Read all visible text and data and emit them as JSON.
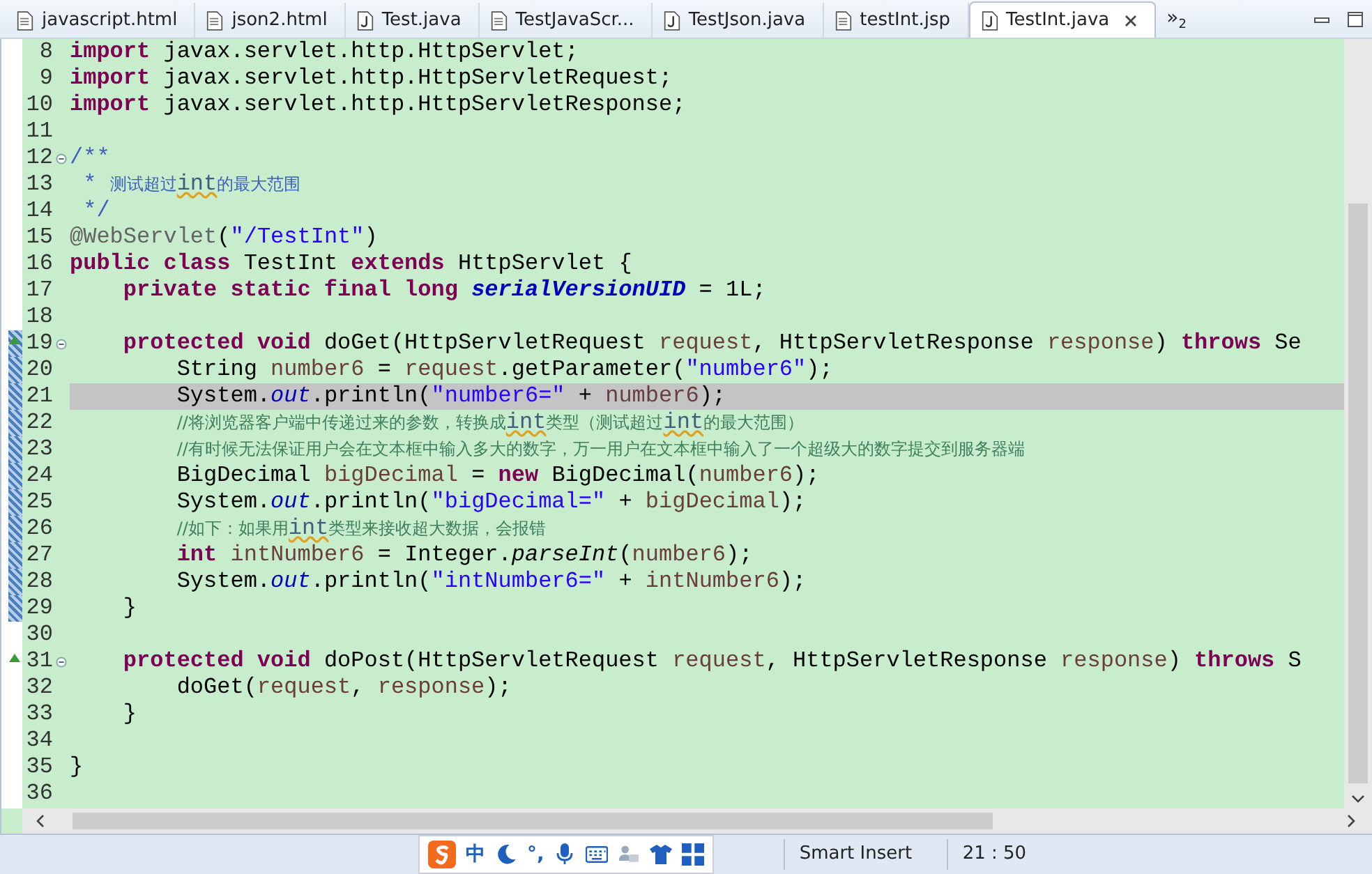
{
  "tabs": [
    {
      "label": "javascript.html",
      "kind": "html",
      "selected": false
    },
    {
      "label": "json2.html",
      "kind": "html",
      "selected": false
    },
    {
      "label": "Test.java",
      "kind": "java",
      "selected": false
    },
    {
      "label": "TestJavaScr...",
      "kind": "html",
      "selected": false
    },
    {
      "label": "TestJson.java",
      "kind": "java",
      "selected": false
    },
    {
      "label": "testInt.jsp",
      "kind": "html",
      "selected": false
    },
    {
      "label": "TestInt.java",
      "kind": "java",
      "selected": true
    }
  ],
  "overflow": {
    "symbol": "»",
    "count": "2"
  },
  "editor": {
    "lines": [
      {
        "number": "8",
        "current": false,
        "changed": false,
        "override": false,
        "foldable": false,
        "tokens": [
          {
            "kind": "kw",
            "text": "import"
          },
          {
            "kind": "plain",
            "text": " javax.servlet.http.HttpServlet;"
          }
        ]
      },
      {
        "number": "9",
        "current": false,
        "changed": false,
        "override": false,
        "foldable": false,
        "tokens": [
          {
            "kind": "kw",
            "text": "import"
          },
          {
            "kind": "plain",
            "text": " javax.servlet.http.HttpServletRequest;"
          }
        ]
      },
      {
        "number": "10",
        "current": false,
        "changed": false,
        "override": false,
        "foldable": false,
        "tokens": [
          {
            "kind": "kw",
            "text": "import"
          },
          {
            "kind": "plain",
            "text": " javax.servlet.http.HttpServletResponse;"
          }
        ]
      },
      {
        "number": "11",
        "current": false,
        "changed": false,
        "override": false,
        "foldable": false
      },
      {
        "number": "12",
        "current": false,
        "changed": false,
        "override": false,
        "foldable": true,
        "tokens": [
          {
            "kind": "doc",
            "text": "/**"
          }
        ]
      },
      {
        "number": "13",
        "current": false,
        "changed": false,
        "override": false,
        "foldable": false,
        "tokens": [
          {
            "kind": "doc",
            "text": " * "
          },
          {
            "kind": "doccjk",
            "text": "测试超过"
          },
          {
            "kind": "spell",
            "text": "int"
          },
          {
            "kind": "doccjk",
            "text": "的最大范围"
          }
        ]
      },
      {
        "number": "14",
        "current": false,
        "changed": false,
        "override": false,
        "foldable": false,
        "tokens": [
          {
            "kind": "doc",
            "text": " */"
          }
        ]
      },
      {
        "number": "15",
        "current": false,
        "changed": false,
        "override": false,
        "foldable": false,
        "tokens": [
          {
            "kind": "ann",
            "text": "@WebServlet"
          },
          {
            "kind": "plain",
            "text": "("
          },
          {
            "kind": "str",
            "text": "\"/TestInt\""
          },
          {
            "kind": "plain",
            "text": ")"
          }
        ]
      },
      {
        "number": "16",
        "current": false,
        "changed": false,
        "override": false,
        "foldable": false,
        "tokens": [
          {
            "kind": "kw",
            "text": "public class"
          },
          {
            "kind": "plain",
            "text": " TestInt "
          },
          {
            "kind": "kw",
            "text": "extends"
          },
          {
            "kind": "plain",
            "text": " HttpServlet {"
          }
        ]
      },
      {
        "number": "17",
        "current": false,
        "changed": false,
        "override": false,
        "foldable": false,
        "tokens": [
          {
            "kind": "kw",
            "text": "    private static final long"
          },
          {
            "kind": "field",
            "text": " serialVersionUID"
          },
          {
            "kind": "plain",
            "text": " = 1L;"
          }
        ]
      },
      {
        "number": "18",
        "current": false,
        "changed": false,
        "override": false,
        "foldable": false
      },
      {
        "number": "19",
        "current": false,
        "changed": true,
        "override": true,
        "foldable": true,
        "tokens": [
          {
            "kind": "kw",
            "text": "    protected void"
          },
          {
            "kind": "plain",
            "text": " doGet(HttpServletRequest "
          },
          {
            "kind": "param",
            "text": "request"
          },
          {
            "kind": "plain",
            "text": ", HttpServletResponse "
          },
          {
            "kind": "param",
            "text": "response"
          },
          {
            "kind": "plain",
            "text": ") "
          },
          {
            "kind": "kw",
            "text": "throws"
          },
          {
            "kind": "plain",
            "text": " Se"
          }
        ]
      },
      {
        "number": "20",
        "current": false,
        "changed": true,
        "override": false,
        "foldable": false,
        "tokens": [
          {
            "kind": "plain",
            "text": "        String "
          },
          {
            "kind": "param",
            "text": "number6"
          },
          {
            "kind": "plain",
            "text": " = "
          },
          {
            "kind": "param",
            "text": "request"
          },
          {
            "kind": "plain",
            "text": ".getParameter("
          },
          {
            "kind": "str",
            "text": "\"number6\""
          },
          {
            "kind": "plain",
            "text": ");"
          }
        ]
      },
      {
        "number": "21",
        "current": true,
        "changed": true,
        "override": false,
        "foldable": false,
        "tokens": [
          {
            "kind": "plain",
            "text": "        System."
          },
          {
            "kind": "sfield",
            "text": "out"
          },
          {
            "kind": "plain",
            "text": ".println("
          },
          {
            "kind": "str",
            "text": "\"number6=\""
          },
          {
            "kind": "plain",
            "text": " + "
          },
          {
            "kind": "param",
            "text": "number6"
          },
          {
            "kind": "plain",
            "text": ");"
          }
        ]
      },
      {
        "number": "22",
        "current": false,
        "changed": true,
        "override": false,
        "foldable": false,
        "tokens": [
          {
            "kind": "cmt",
            "text": "        //将浏览器客户端中传递过来的参数，转换成"
          },
          {
            "kind": "spell",
            "text": "int"
          },
          {
            "kind": "cmt",
            "text": "类型（测试超过"
          },
          {
            "kind": "spell",
            "text": "int"
          },
          {
            "kind": "cmt",
            "text": "的最大范围）"
          }
        ]
      },
      {
        "number": "23",
        "current": false,
        "changed": true,
        "override": false,
        "foldable": false,
        "tokens": [
          {
            "kind": "cmt",
            "text": "        //有时候无法保证用户会在文本框中输入多大的数字，万一用户在文本框中输入了一个超级大的数字提交到服务器端"
          }
        ]
      },
      {
        "number": "24",
        "current": false,
        "changed": true,
        "override": false,
        "foldable": false,
        "tokens": [
          {
            "kind": "plain",
            "text": "        BigDecimal "
          },
          {
            "kind": "param",
            "text": "bigDecimal"
          },
          {
            "kind": "plain",
            "text": " = "
          },
          {
            "kind": "kw",
            "text": "new"
          },
          {
            "kind": "plain",
            "text": " BigDecimal("
          },
          {
            "kind": "param",
            "text": "number6"
          },
          {
            "kind": "plain",
            "text": ");"
          }
        ]
      },
      {
        "number": "25",
        "current": false,
        "changed": true,
        "override": false,
        "foldable": false,
        "tokens": [
          {
            "kind": "plain",
            "text": "        System."
          },
          {
            "kind": "sfield",
            "text": "out"
          },
          {
            "kind": "plain",
            "text": ".println("
          },
          {
            "kind": "str",
            "text": "\"bigDecimal=\""
          },
          {
            "kind": "plain",
            "text": " + "
          },
          {
            "kind": "param",
            "text": "bigDecimal"
          },
          {
            "kind": "plain",
            "text": ");"
          }
        ]
      },
      {
        "number": "26",
        "current": false,
        "changed": true,
        "override": false,
        "foldable": false,
        "tokens": [
          {
            "kind": "cmt",
            "text": "        //如下：如果用"
          },
          {
            "kind": "spell",
            "text": "int"
          },
          {
            "kind": "cmt",
            "text": "类型来接收超大数据，会报错"
          }
        ]
      },
      {
        "number": "27",
        "current": false,
        "changed": true,
        "override": false,
        "foldable": false,
        "tokens": [
          {
            "kind": "kw",
            "text": "        int"
          },
          {
            "kind": "param",
            "text": " intNumber6"
          },
          {
            "kind": "plain",
            "text": " = Integer."
          },
          {
            "kind": "smethod",
            "text": "parseInt"
          },
          {
            "kind": "plain",
            "text": "("
          },
          {
            "kind": "param",
            "text": "number6"
          },
          {
            "kind": "plain",
            "text": ");"
          }
        ]
      },
      {
        "number": "28",
        "current": false,
        "changed": true,
        "override": false,
        "foldable": false,
        "tokens": [
          {
            "kind": "plain",
            "text": "        System."
          },
          {
            "kind": "sfield",
            "text": "out"
          },
          {
            "kind": "plain",
            "text": ".println("
          },
          {
            "kind": "str",
            "text": "\"intNumber6=\""
          },
          {
            "kind": "plain",
            "text": " + "
          },
          {
            "kind": "param",
            "text": "intNumber6"
          },
          {
            "kind": "plain",
            "text": ");"
          }
        ]
      },
      {
        "number": "29",
        "current": false,
        "changed": true,
        "override": false,
        "foldable": false,
        "tokens": [
          {
            "kind": "plain",
            "text": "    }"
          }
        ]
      },
      {
        "number": "30",
        "current": false,
        "changed": false,
        "override": false,
        "foldable": false
      },
      {
        "number": "31",
        "current": false,
        "changed": false,
        "override": true,
        "foldable": true,
        "tokens": [
          {
            "kind": "kw",
            "text": "    protected void"
          },
          {
            "kind": "plain",
            "text": " doPost(HttpServletRequest "
          },
          {
            "kind": "param",
            "text": "request"
          },
          {
            "kind": "plain",
            "text": ", HttpServletResponse "
          },
          {
            "kind": "param",
            "text": "response"
          },
          {
            "kind": "plain",
            "text": ") "
          },
          {
            "kind": "kw",
            "text": "throws"
          },
          {
            "kind": "plain",
            "text": " S"
          }
        ]
      },
      {
        "number": "32",
        "current": false,
        "changed": false,
        "override": false,
        "foldable": false,
        "tokens": [
          {
            "kind": "plain",
            "text": "        doGet("
          },
          {
            "kind": "param",
            "text": "request"
          },
          {
            "kind": "plain",
            "text": ", "
          },
          {
            "kind": "param",
            "text": "response"
          },
          {
            "kind": "plain",
            "text": ");"
          }
        ]
      },
      {
        "number": "33",
        "current": false,
        "changed": false,
        "override": false,
        "foldable": false,
        "tokens": [
          {
            "kind": "plain",
            "text": "    }"
          }
        ]
      },
      {
        "number": "34",
        "current": false,
        "changed": false,
        "override": false,
        "foldable": false
      },
      {
        "number": "35",
        "current": false,
        "changed": false,
        "override": false,
        "foldable": false,
        "tokens": [
          {
            "kind": "plain",
            "text": "}"
          }
        ]
      },
      {
        "number": "36",
        "current": false,
        "changed": false,
        "override": false,
        "foldable": false
      }
    ]
  },
  "ime": {
    "mode": "中",
    "punctuation": "°,"
  },
  "status_bar": {
    "insert_mode": "Smart Insert",
    "position": "21 : 50"
  }
}
